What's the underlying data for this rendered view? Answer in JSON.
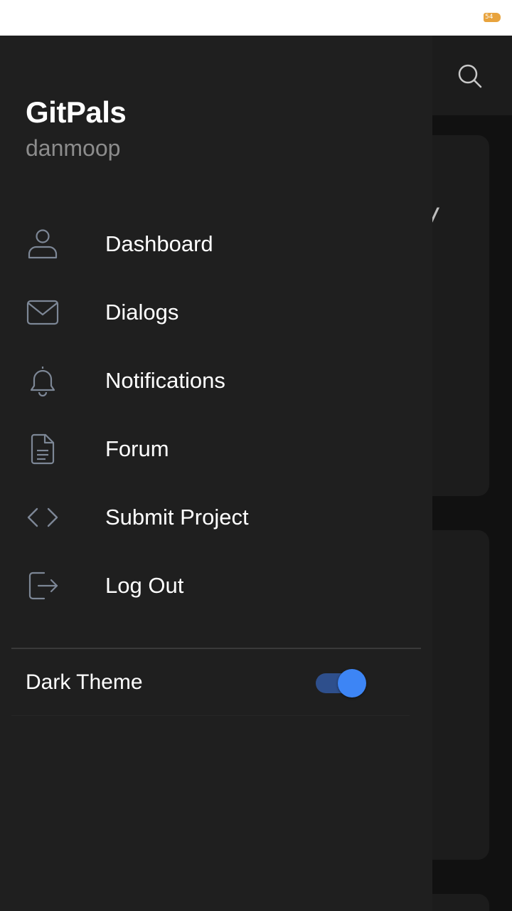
{
  "status_bar": {
    "battery_level": "54",
    "battery_color": "#e8a33d"
  },
  "background_app": {
    "partial_glyph": "/"
  },
  "drawer": {
    "app_name": "GitPals",
    "username": "danmoop",
    "items": [
      {
        "label": "Dashboard",
        "icon": "person-icon"
      },
      {
        "label": "Dialogs",
        "icon": "mail-icon"
      },
      {
        "label": "Notifications",
        "icon": "bell-icon"
      },
      {
        "label": "Forum",
        "icon": "document-icon"
      },
      {
        "label": "Submit Project",
        "icon": "code-icon"
      },
      {
        "label": "Log Out",
        "icon": "logout-icon"
      }
    ],
    "theme_toggle": {
      "label": "Dark Theme",
      "enabled": true,
      "accent": "#3d85f5"
    }
  }
}
